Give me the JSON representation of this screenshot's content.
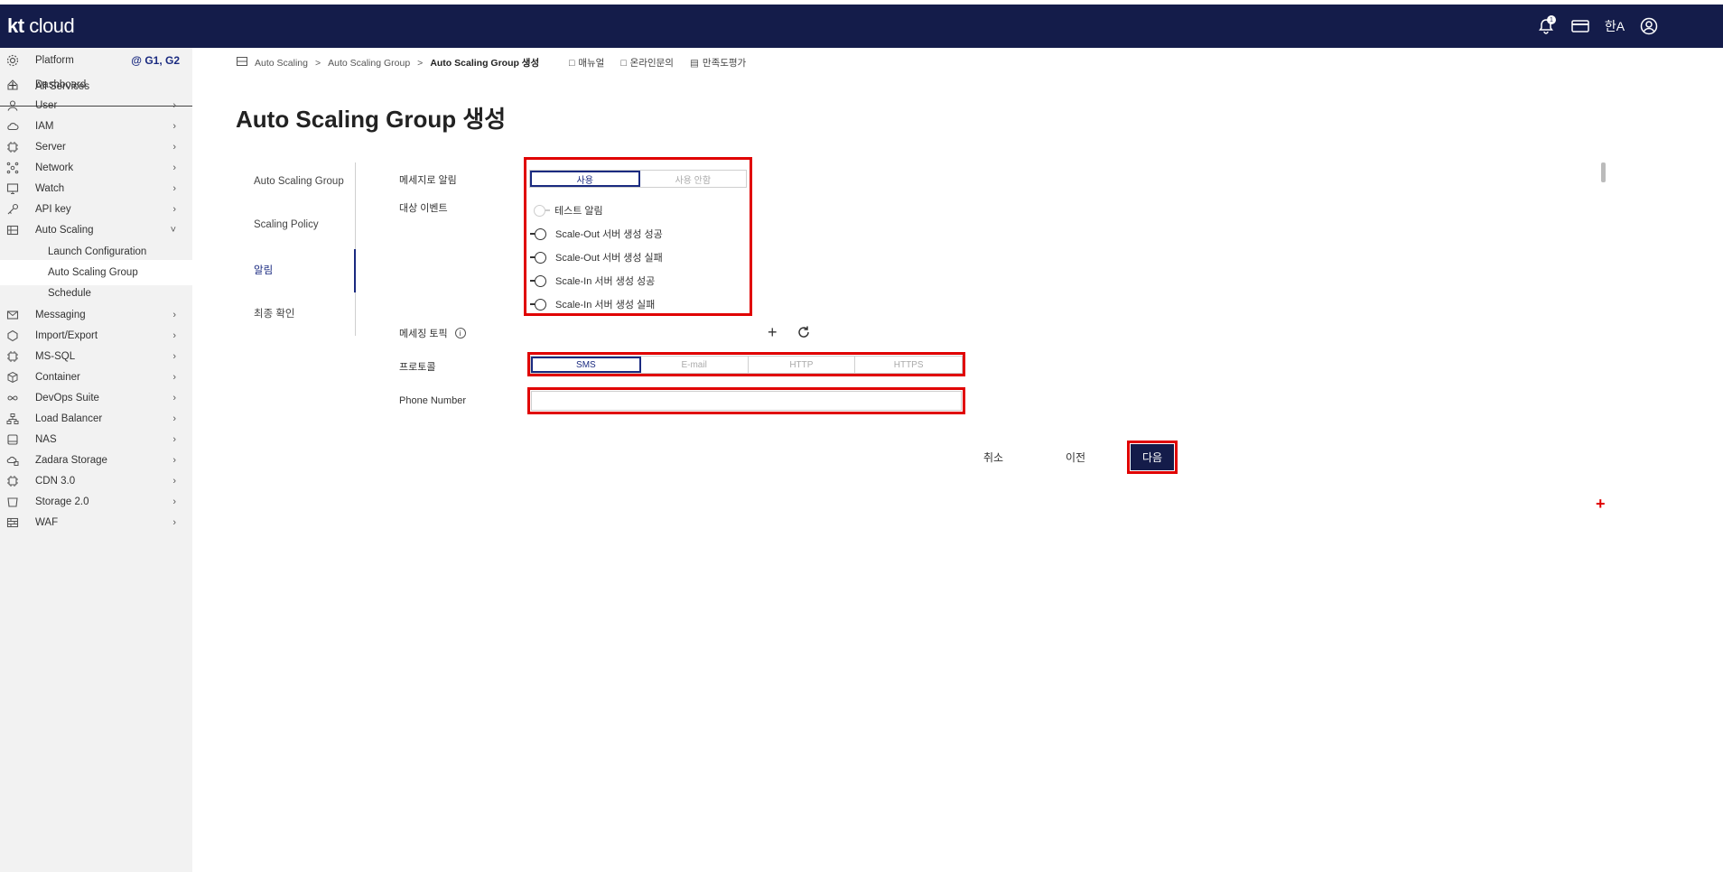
{
  "app": {
    "logo_kt": "kt",
    "logo_cloud": "cloud"
  },
  "topbar": {
    "icons": [
      "bell-icon",
      "card-icon",
      "language-icon",
      "user-icon"
    ],
    "bell_badge": "1"
  },
  "sidebar": {
    "platform_label": "Platform",
    "platform_badge": "@ G1, G2",
    "all_services": "All Services",
    "items": [
      {
        "label": "Dashboard",
        "icon": "home-icon"
      },
      {
        "label": "User",
        "icon": "user-icon"
      },
      {
        "label": "IAM",
        "icon": "cloud-icon"
      },
      {
        "label": "Server",
        "icon": "chip-icon"
      },
      {
        "label": "Network",
        "icon": "network-icon"
      },
      {
        "label": "Watch",
        "icon": "monitor-icon"
      },
      {
        "label": "API key",
        "icon": "key-icon"
      },
      {
        "label": "Auto Scaling",
        "icon": "scaling-icon"
      }
    ],
    "subitems": [
      "Launch Configuration",
      "Auto Scaling Group",
      "Schedule"
    ],
    "items2": [
      {
        "label": "Messaging",
        "icon": "mail-icon"
      },
      {
        "label": "Import/Export",
        "icon": "import-icon"
      },
      {
        "label": "MS-SQL",
        "icon": "chip-icon"
      },
      {
        "label": "Container",
        "icon": "box-icon"
      },
      {
        "label": "DevOps Suite",
        "icon": "infinity-icon"
      },
      {
        "label": "Load Balancer",
        "icon": "balancer-icon"
      },
      {
        "label": "NAS",
        "icon": "disk-icon"
      },
      {
        "label": "Zadara Storage",
        "icon": "cloud-storage-icon"
      },
      {
        "label": "CDN 3.0",
        "icon": "chip-icon"
      },
      {
        "label": "Storage 2.0",
        "icon": "bucket-icon"
      },
      {
        "label": "WAF",
        "icon": "firewall-icon"
      }
    ]
  },
  "breadcrumb": {
    "items": [
      "Auto Scaling",
      "Auto Scaling Group",
      "Auto Scaling Group 생성"
    ],
    "sep": ">"
  },
  "header_links": {
    "manual": "매뉴얼",
    "inquiry": "온라인문의",
    "survey": "만족도평가"
  },
  "page_title": "Auto Scaling Group 생성",
  "steps": [
    "Auto Scaling Group",
    "Scaling Policy",
    "알림",
    "최종 확인"
  ],
  "form": {
    "message_alert_label": "메세지로 알림",
    "alert_options": [
      "사용",
      "사용 안함"
    ],
    "target_event_label": "대상 이벤트",
    "events": [
      "테스트 알림",
      "Scale-Out 서버 생성 성공",
      "Scale-Out 서버 생성 실패",
      "Scale-In 서버 생성 성공",
      "Scale-In 서버 생성 실패"
    ],
    "topic_label": "메세징 토픽",
    "protocol_label": "프로토콜",
    "protocols": [
      "SMS",
      "E-mail",
      "HTTP",
      "HTTPS"
    ],
    "phone_label": "Phone Number",
    "phone_value": ""
  },
  "buttons": {
    "cancel": "취소",
    "prev": "이전",
    "next": "다음"
  },
  "colors": {
    "navy": "#141c4a",
    "highlight_red": "#e00000"
  }
}
